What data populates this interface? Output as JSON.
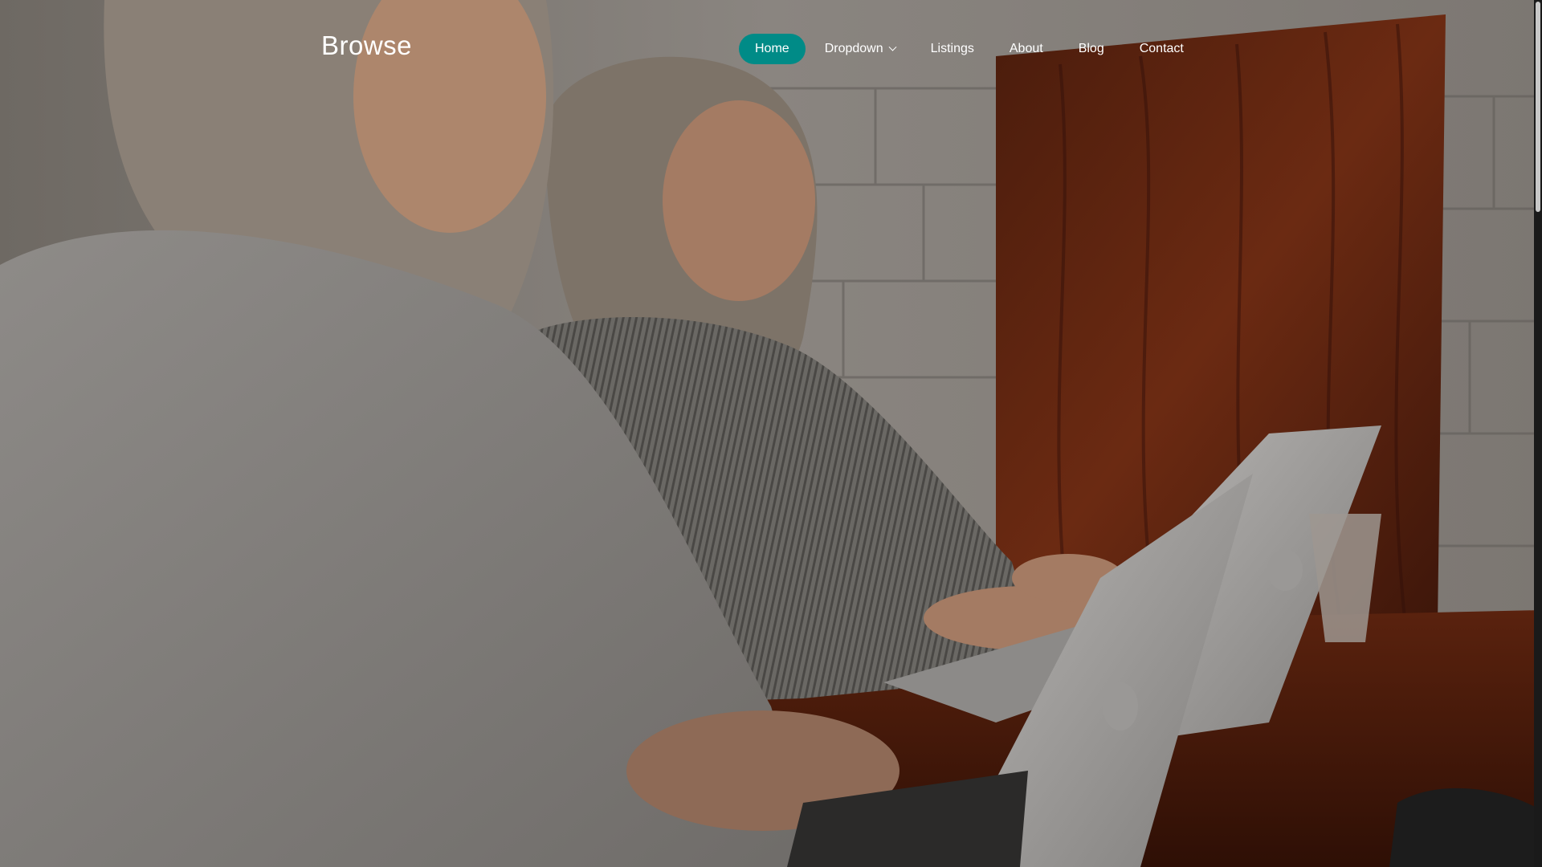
{
  "brand": "Browse",
  "nav": {
    "items": [
      {
        "label": "Home",
        "active": true
      },
      {
        "label": "Dropdown",
        "dropdown": true
      },
      {
        "label": "Listings"
      },
      {
        "label": "About"
      },
      {
        "label": "Blog"
      },
      {
        "label": "Contact"
      }
    ]
  },
  "colors": {
    "accent": "#008b87",
    "overlay": "#000000"
  },
  "hero": {
    "image": "two-women-working-on-laptops-photo"
  }
}
